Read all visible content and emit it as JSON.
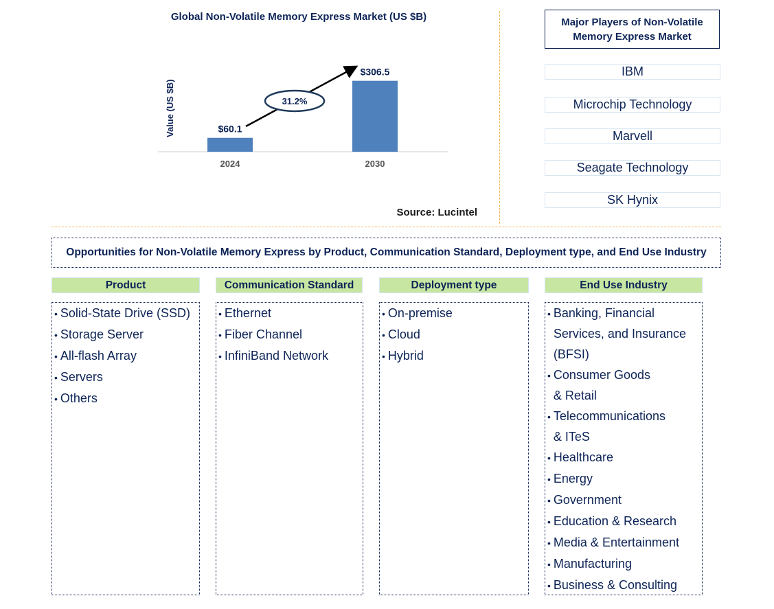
{
  "chart_data": {
    "type": "bar",
    "title": "Global Non-Volatile Memory Express Market (US $B)",
    "xlabel": "",
    "ylabel": "Value (US $B)",
    "categories": [
      "2024",
      "2030"
    ],
    "values": [
      60.1,
      306.5
    ],
    "data_labels": [
      "$60.1",
      "$306.5"
    ],
    "annotation": {
      "text": "31.2%",
      "meaning": "CAGR 2024-2030"
    },
    "ylim": [
      0,
      350
    ],
    "grid": false,
    "bar_color": "#4f81bd"
  },
  "source": "Source: Lucintel",
  "players": {
    "title": "Major Players of Non-Volatile Memory Express Market",
    "items": [
      "IBM",
      "Microchip Technology",
      "Marvell",
      "Seagate Technology",
      "SK Hynix"
    ]
  },
  "opportunities": {
    "title": "Opportunities for Non-Volatile Memory Express by Product, Communication Standard, Deployment type, and End Use Industry",
    "categories": [
      {
        "label": "Product",
        "items": [
          "Solid-State Drive (SSD)",
          "Storage Server",
          "All-flash Array",
          "Servers",
          "Others"
        ]
      },
      {
        "label": "Communication Standard",
        "items": [
          "Ethernet",
          "Fiber Channel",
          "InfiniBand Network"
        ]
      },
      {
        "label": "Deployment type",
        "items": [
          "On-premise",
          "Cloud",
          "Hybrid"
        ]
      },
      {
        "label": "End Use Industry",
        "items": [
          "Banking, Financial\nServices, and Insurance\n(BFSI)",
          "Consumer Goods\n& Retail",
          "Telecommunications\n& ITeS",
          "Healthcare",
          "Energy",
          "Government",
          "Education & Research",
          "Media & Entertainment",
          "Manufacturing",
          "Business & Consulting"
        ]
      }
    ]
  },
  "colors": {
    "title_text": "#0d2457",
    "bar": "#4f81bd",
    "category_header_bg": "#c7e6a2",
    "divider": "#f0b94a"
  }
}
